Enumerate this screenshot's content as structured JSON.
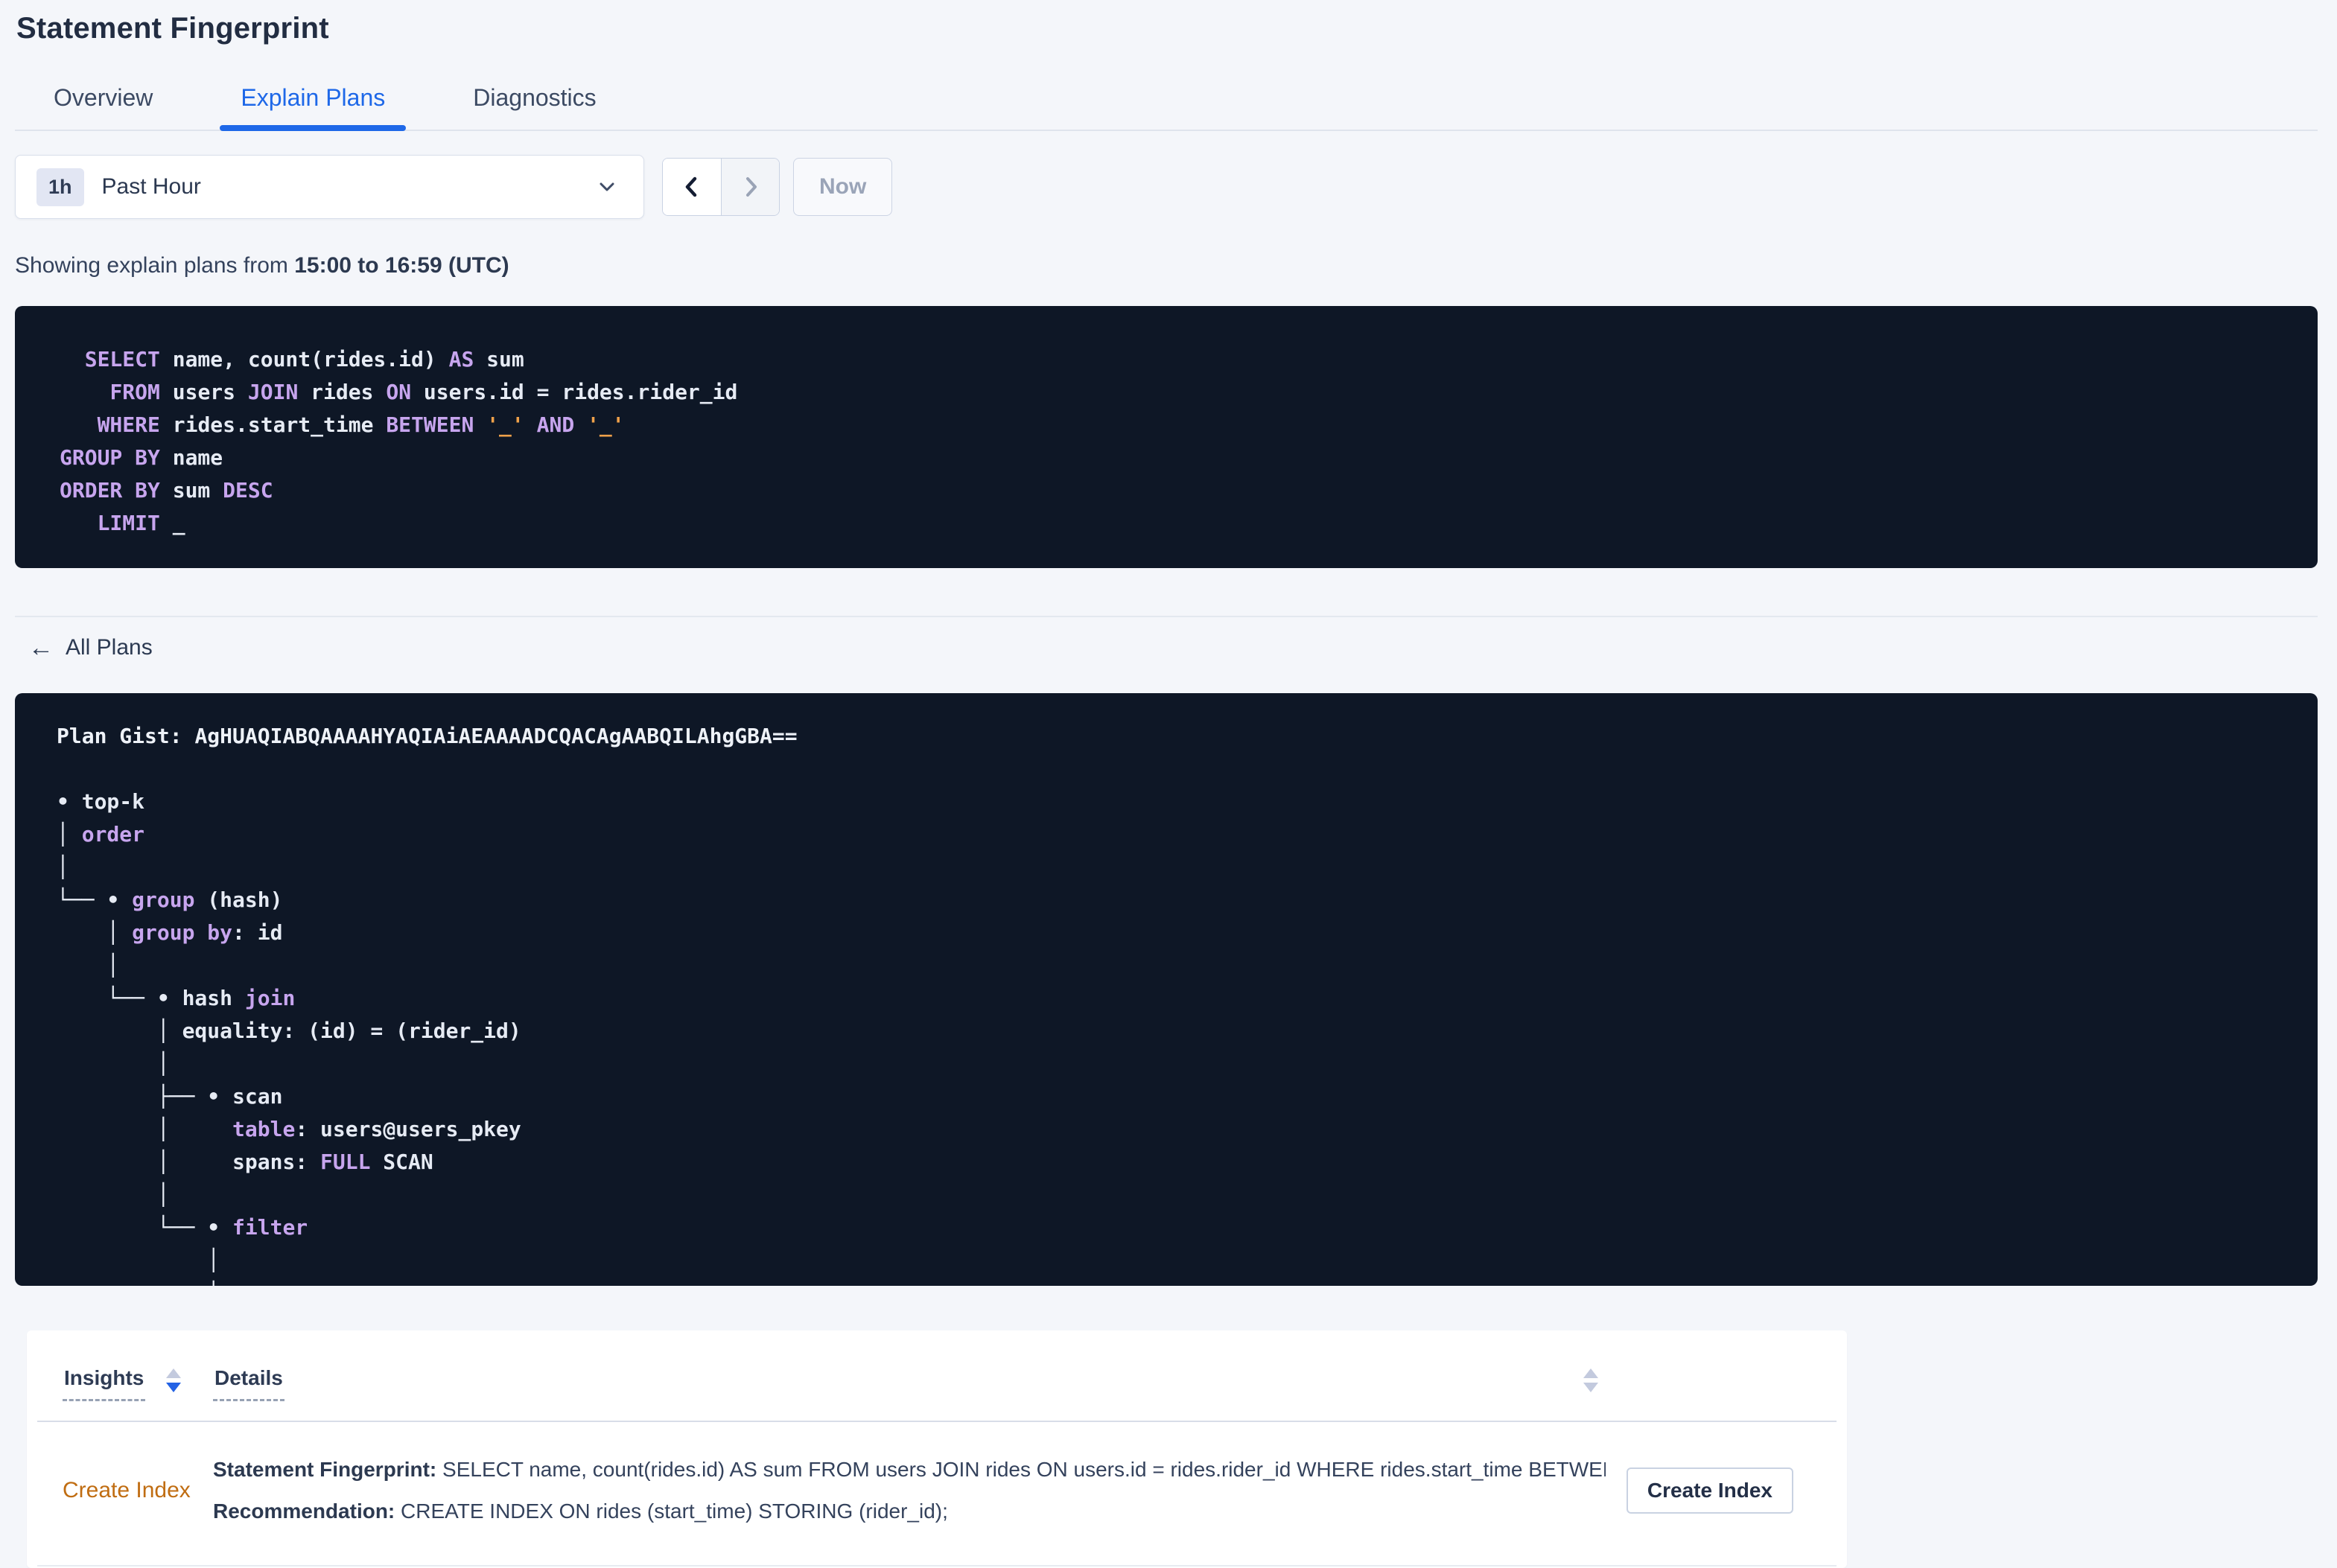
{
  "colors": {
    "accent_blue": "#1e68e8",
    "code_background": "#0e1726",
    "code_keyword_purple": "#c7a5ee",
    "code_text_white": "#e6ebf4",
    "code_literal_orange": "#efa14a",
    "insight_link_orange": "#c06d12",
    "sort_active_blue": "#2462e4",
    "sort_inactive_gray": "#c3cade"
  },
  "header": {
    "title": "Statement Fingerprint"
  },
  "tabs": [
    {
      "label": "Overview",
      "active": false
    },
    {
      "label": "Explain Plans",
      "active": true
    },
    {
      "label": "Diagnostics",
      "active": false
    }
  ],
  "time_picker": {
    "badge": "1h",
    "selected": "Past Hour",
    "now_label": "Now"
  },
  "status_line": {
    "prefix": "Showing explain plans from ",
    "range_bold": "15:00 to 16:59 (UTC)"
  },
  "sql_box": {
    "lines": [
      [
        [
          "kw",
          "  SELECT"
        ],
        [
          "pl",
          " name, count(rides.id) "
        ],
        [
          "kw",
          "AS"
        ],
        [
          "pl",
          " sum"
        ]
      ],
      [
        [
          "pl",
          "    "
        ],
        [
          "kw",
          "FROM"
        ],
        [
          "pl",
          " users "
        ],
        [
          "kw",
          "JOIN"
        ],
        [
          "pl",
          " rides "
        ],
        [
          "kw",
          "ON"
        ],
        [
          "pl",
          " users.id = rides.rider_id"
        ]
      ],
      [
        [
          "pl",
          "   "
        ],
        [
          "kw",
          "WHERE"
        ],
        [
          "pl",
          " rides.start_time "
        ],
        [
          "kw",
          "BETWEEN"
        ],
        [
          "pl",
          " "
        ],
        [
          "lit",
          "'_'"
        ],
        [
          "pl",
          " "
        ],
        [
          "kw",
          "AND"
        ],
        [
          "pl",
          " "
        ],
        [
          "lit",
          "'_'"
        ]
      ],
      [
        [
          "kw",
          "GROUP BY"
        ],
        [
          "pl",
          " name"
        ]
      ],
      [
        [
          "kw",
          "ORDER BY"
        ],
        [
          "pl",
          " sum "
        ],
        [
          "kw",
          "DESC"
        ]
      ],
      [
        [
          "pl",
          "   "
        ],
        [
          "kw",
          "LIMIT"
        ],
        [
          "pl",
          " _"
        ]
      ]
    ]
  },
  "all_plans": {
    "label": "All Plans"
  },
  "plan_box": {
    "gist_label": "Plan Gist: ",
    "gist_value": "AgHUAQIABQAAAAHYAQIAiAEAAAADCQACAgAABQILAhgGBA==",
    "tree_lines": [
      [
        [
          "pl",
          "• top-k"
        ]
      ],
      [
        [
          "pl",
          "│ "
        ],
        [
          "kw",
          "order"
        ]
      ],
      [
        [
          "pl",
          "│"
        ]
      ],
      [
        [
          "pl",
          "└── • "
        ],
        [
          "kw",
          "group"
        ],
        [
          "pl",
          " (hash)"
        ]
      ],
      [
        [
          "pl",
          "    │ "
        ],
        [
          "kw",
          "group by"
        ],
        [
          "pl",
          ": id"
        ]
      ],
      [
        [
          "pl",
          "    │"
        ]
      ],
      [
        [
          "pl",
          "    └── • hash "
        ],
        [
          "kw",
          "join"
        ]
      ],
      [
        [
          "pl",
          "        │ equality: (id) = (rider_id)"
        ]
      ],
      [
        [
          "pl",
          "        │"
        ]
      ],
      [
        [
          "pl",
          "        ├── • scan"
        ]
      ],
      [
        [
          "pl",
          "        │     "
        ],
        [
          "kw",
          "table"
        ],
        [
          "pl",
          ": users@users_pkey"
        ]
      ],
      [
        [
          "pl",
          "        │     spans: "
        ],
        [
          "kw",
          "FULL"
        ],
        [
          "pl",
          " SCAN"
        ]
      ],
      [
        [
          "pl",
          "        │"
        ]
      ],
      [
        [
          "pl",
          "        └── • "
        ],
        [
          "kw",
          "filter"
        ]
      ],
      [
        [
          "pl",
          "            │"
        ]
      ],
      [
        [
          "pl",
          "            │"
        ]
      ]
    ]
  },
  "insights_table": {
    "columns": [
      {
        "label": "Insights",
        "sort": "desc"
      },
      {
        "label": "Details",
        "sort": "inactive"
      }
    ],
    "rows": [
      {
        "insight": "Create Index",
        "fingerprint_label": "Statement Fingerprint:",
        "fingerprint_text": " SELECT name, count(rides.id) AS sum FROM users JOIN rides ON users.id = rides.rider_id WHERE rides.start_time BETWEEN '_…",
        "recommendation_label": "Recommendation:",
        "recommendation_text": " CREATE INDEX ON rides (start_time) STORING (rider_id);",
        "action_label": "Create Index"
      }
    ]
  }
}
